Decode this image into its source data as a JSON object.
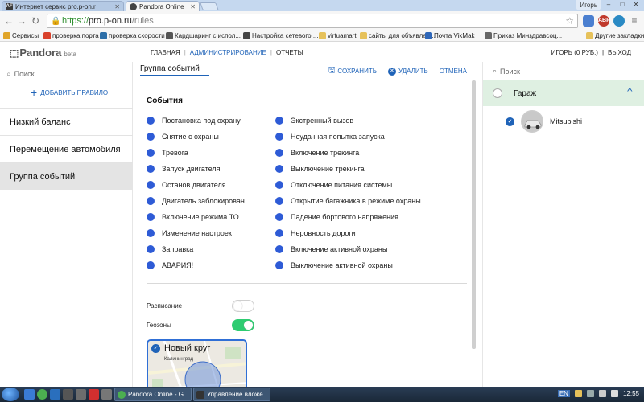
{
  "browser": {
    "tabs": [
      {
        "label": "Интернет сервис pro.p-on.r",
        "favicon": "AF"
      },
      {
        "label": "Pandora Online"
      }
    ],
    "user_chip": "Игорь",
    "window_buttons": [
      "–",
      "□",
      "✕"
    ],
    "url": {
      "scheme": "https://",
      "host": "pro.p-on.ru",
      "path": "/rules"
    },
    "ext_abp": "ABP",
    "bookmarks": [
      "Сервисы",
      "проверка порта",
      "проверка скорости",
      "Кардшаринг с испол...",
      "Настройка сетевого ...",
      "virtuamart",
      "сайты для объявлен...",
      "Почта VikMak",
      "Приказ Минздравсоц...",
      "Другие закладки"
    ]
  },
  "header": {
    "logo": "Pandora",
    "logo_suffix": "beta",
    "nav": [
      "ГЛАВНАЯ",
      "АДМИНИСТРИРОВАНИЕ",
      "ОТЧЕТЫ"
    ],
    "user": "ИГОРЬ (0 РУБ.)",
    "logout": "ВЫХОД"
  },
  "sidebar": {
    "search_placeholder": "Поиск",
    "add_rule": "ДОБАВИТЬ ПРАВИЛО",
    "items": [
      "Низкий баланс",
      "Перемещение автомобиля",
      "Группа событий"
    ],
    "active_index": 2
  },
  "main": {
    "rule_name": "Группа событий",
    "actions": {
      "save": "СОХРАНИТЬ",
      "delete": "УДАЛИТЬ",
      "cancel": "ОТМЕНА"
    },
    "events_title": "События",
    "events_col1": [
      "Постановка под охрану",
      "Снятие с охраны",
      "Тревога",
      "Запуск двигателя",
      "Останов двигателя",
      "Двигатель заблокирован",
      "Включение режима ТО",
      "Изменение настроек",
      "Заправка",
      "АВАРИЯ!"
    ],
    "events_col2": [
      "Экстренный вызов",
      "Неудачная попытка запуска",
      "Включение трекинга",
      "Выключение трекинга",
      "Отключение питания системы",
      "Открытие багажника в режиме охраны",
      "Падение бортового напряжения",
      "Неровность дороги",
      "Включение активной охраны",
      "Выключение активной охраны"
    ],
    "schedule_label": "Расписание",
    "schedule_on": false,
    "geozones_label": "Геозоны",
    "geozones_on": true,
    "geozone_card": {
      "title": "Новый круг",
      "city": "Калининград"
    }
  },
  "right_panel": {
    "search_placeholder": "Поиск",
    "group": "Гараж",
    "vehicle": "Mitsubishi"
  },
  "taskbar": {
    "windows": [
      "Pandora Online - G...",
      "Управление вложе..."
    ],
    "lang": "EN",
    "clock": "12:55"
  },
  "colors": {
    "accent": "#1f63b8",
    "event_dot": "#2e5bd6",
    "toggle_on": "#2ecc71",
    "garage_bg": "#dff0e2"
  }
}
